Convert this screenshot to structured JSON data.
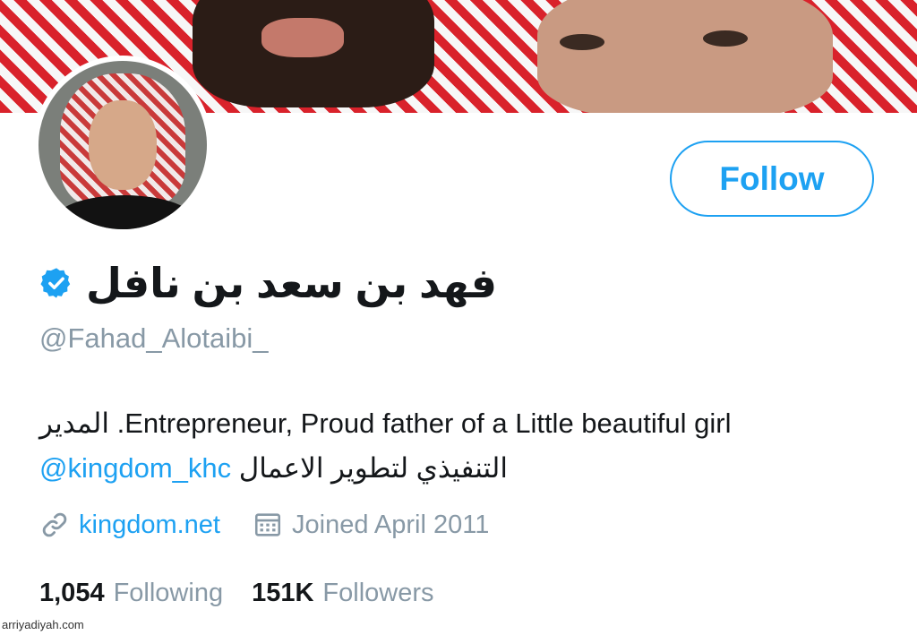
{
  "profile": {
    "display_name": "فهد بن سعد بن نافل",
    "handle": "@Fahad_Alotaibi_",
    "verified_icon": "verified-badge-icon",
    "bio": {
      "line1": "المدير .Entrepreneur, Proud father of a Little beautiful girl",
      "line2_mention": "@kingdom_khc",
      "line2_text": "التنفيذي لتطوير الاعمال"
    },
    "website": "kingdom.net",
    "joined": "Joined April 2011"
  },
  "actions": {
    "follow_label": "Follow"
  },
  "stats": {
    "following_count": "1,054",
    "following_label": "Following",
    "followers_count": "151K",
    "followers_label": "Followers"
  },
  "watermark": "arriyadiyah.com",
  "colors": {
    "accent": "#1da1f2",
    "muted": "#8899a6",
    "text": "#14171a"
  }
}
